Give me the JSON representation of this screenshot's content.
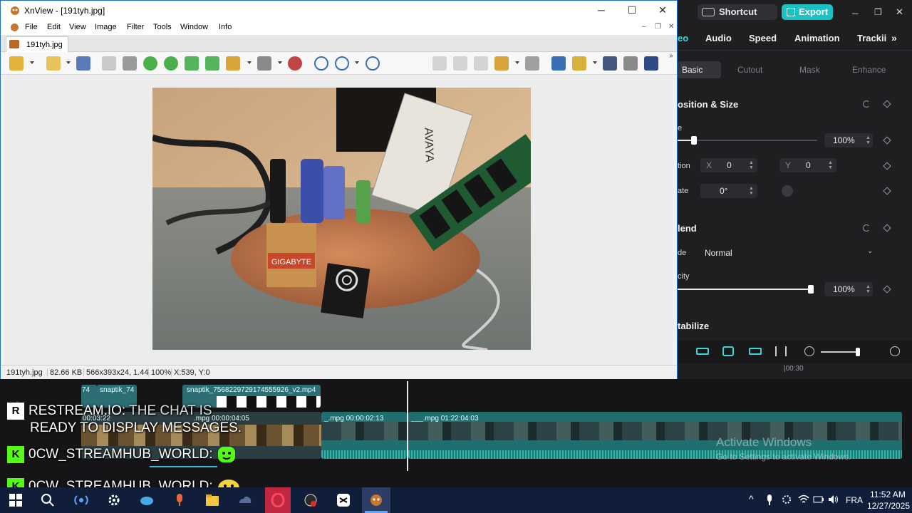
{
  "xnview": {
    "title": "XnView - [191tyh.jpg]",
    "window_buttons": {
      "minimize": "─",
      "maximize": "☐",
      "close": "✕"
    },
    "menu": [
      "File",
      "Edit",
      "View",
      "Image",
      "Filter",
      "Tools",
      "Window",
      "Info"
    ],
    "mdi_buttons": {
      "minimize": "–",
      "restore": "❐",
      "close": "✕"
    },
    "tab": "191tyh.jpg",
    "overflow": "»",
    "status": {
      "filename": "191tyh.jpg",
      "filesize": "82.66 KB",
      "dims": "566x393x24, 1.44",
      "zoom": "100%",
      "coords": "X:539, Y:0"
    },
    "photo_labels": {
      "card": "AVAYA",
      "chip": "GIGABYTE"
    }
  },
  "capcut": {
    "shortcut": "Shortcut",
    "export": "Export",
    "panel_tabs": [
      "eo",
      "Audio",
      "Speed",
      "Animation",
      "Trackii"
    ],
    "sub_tabs": [
      "Basic",
      "Cutout",
      "Mask",
      "Enhance"
    ],
    "sections": {
      "position": "osition & Size",
      "blend": "lend",
      "stabilize": "tabilize"
    },
    "scale": {
      "label": "e",
      "value": "100%",
      "level": 0.05
    },
    "position": {
      "label": "tion",
      "x_label": "X",
      "x_value": "0",
      "y_label": "Y",
      "y_value": "0"
    },
    "rotate": {
      "label": "ate",
      "value": "0°"
    },
    "mode": {
      "label": "de",
      "value": "Normal"
    },
    "opacity": {
      "label": "city",
      "value": "100%",
      "level": 1.0
    },
    "timecode_mark": "|00:30"
  },
  "timeline": {
    "clips": [
      {
        "label": "74"
      },
      {
        "label": "snaptik_74"
      },
      {
        "label": "snaptik_7568229729174555926_v2.mp4"
      },
      {
        "label": "00:03:22"
      },
      {
        "label": ".mpg  00:00:04:05"
      },
      {
        "label": "_.mpg   00:00:02:13"
      },
      {
        "label": "___.mpg   01:22:04:03"
      }
    ]
  },
  "chat": [
    {
      "badge": "R",
      "name": "RESTREAM.IO:",
      "message": "THE CHAT IS",
      "message2": "READY TO DISPLAY MESSAGES."
    },
    {
      "badge": "K",
      "name": "0CW_STREAMHUB_WORLD:",
      "emote": "green-face"
    },
    {
      "badge": "K",
      "name": "0CW_STREAMHUB_WORLD:",
      "emote": "yellow-face"
    }
  ],
  "watermark": {
    "line1": "Activate Windows",
    "line2": "Go to Settings to activate Windows."
  },
  "taskbar": {
    "lang": "FRA",
    "time": "11:52 AM",
    "date": "12/27/2025",
    "tray_up": "^"
  },
  "colors": {
    "xn_accent": "#1e73c8",
    "capcut_export": "#19c3c3",
    "taskbar": "#101e3a",
    "clip": "#1f6f6f"
  }
}
